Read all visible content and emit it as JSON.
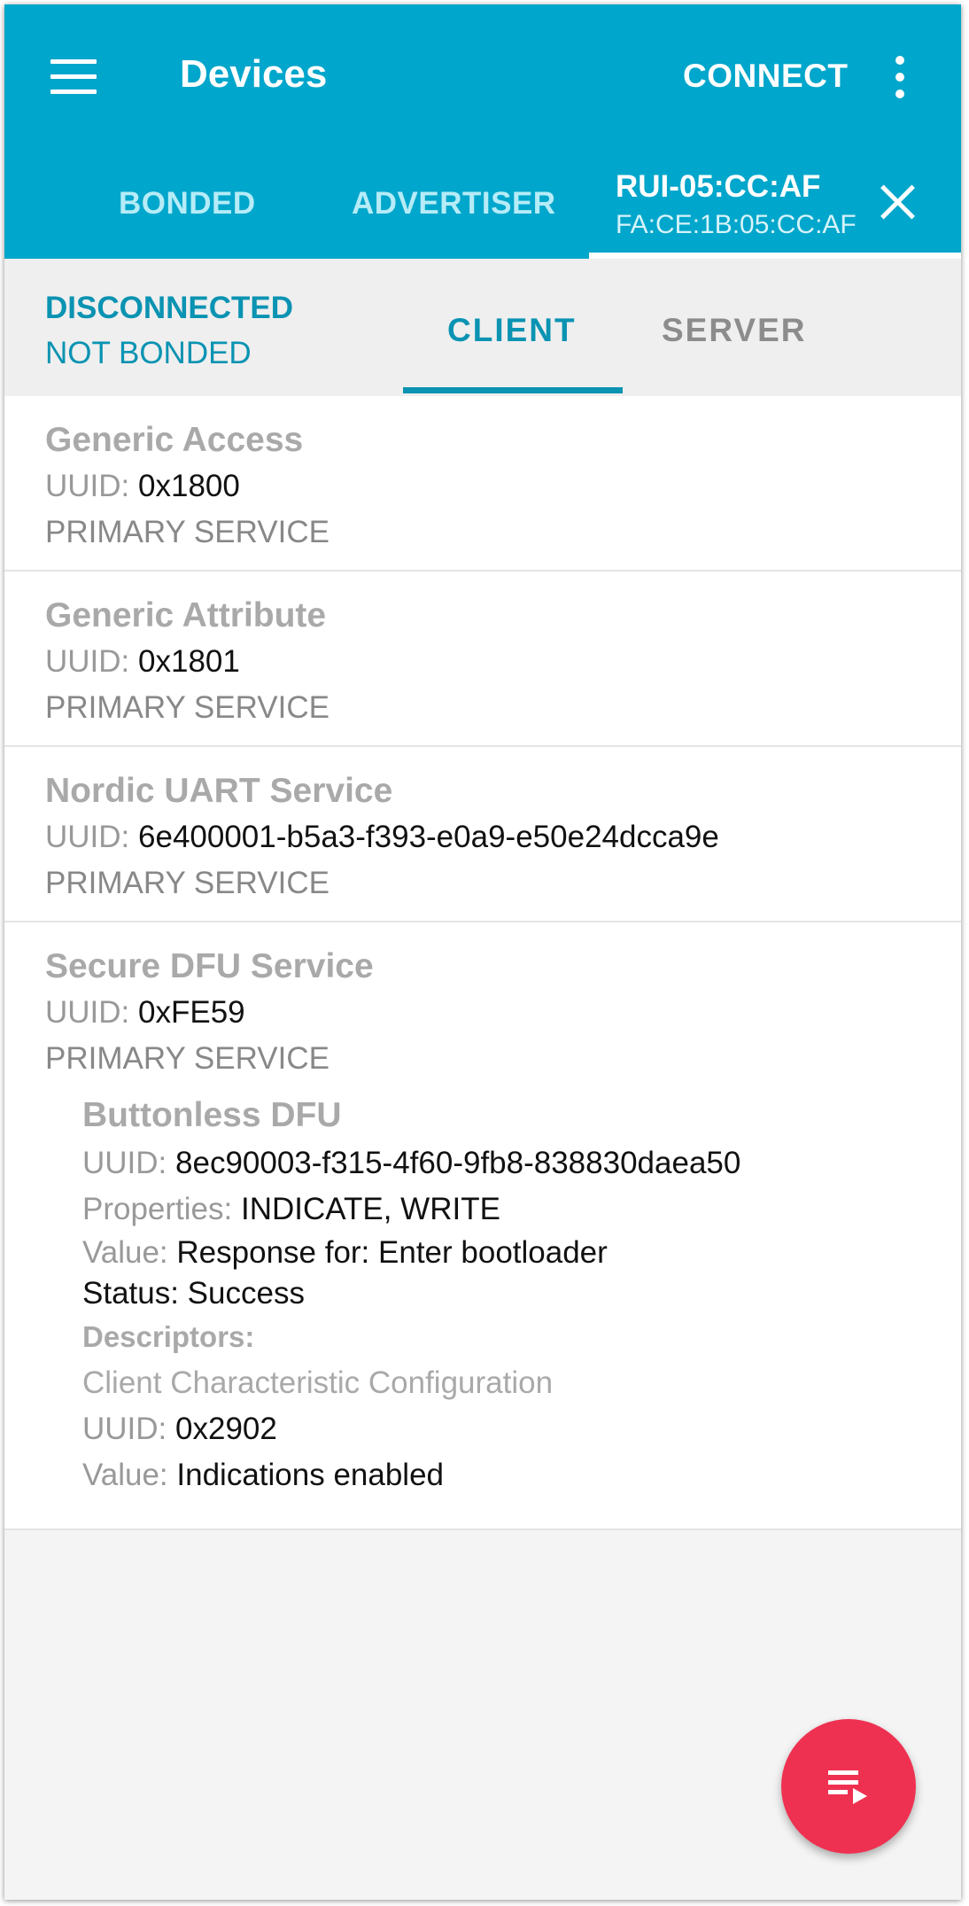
{
  "appbar": {
    "title": "Devices",
    "connect_label": "CONNECT",
    "tabs": [
      {
        "label": "BONDED"
      },
      {
        "label": "ADVERTISER"
      }
    ],
    "device_tab": {
      "name": "RUI-05:CC:AF",
      "address": "FA:CE:1B:05:CC:AF"
    }
  },
  "colors": {
    "primary": "#00a6cb",
    "accent": "#ef3151",
    "status": "#0a93b2"
  },
  "subbar": {
    "connection_status": "DISCONNECTED",
    "bond_status": "NOT BONDED",
    "tabs": [
      {
        "label": "CLIENT",
        "selected": true
      },
      {
        "label": "SERVER",
        "selected": false
      }
    ]
  },
  "services": [
    {
      "name": "Generic Access",
      "uuid_label": "UUID:",
      "uuid": "0x1800",
      "type": "PRIMARY SERVICE"
    },
    {
      "name": "Generic Attribute",
      "uuid_label": "UUID:",
      "uuid": "0x1801",
      "type": "PRIMARY SERVICE"
    },
    {
      "name": "Nordic UART Service",
      "uuid_label": "UUID:",
      "uuid": "6e400001-b5a3-f393-e0a9-e50e24dcca9e",
      "type": "PRIMARY SERVICE"
    },
    {
      "name": "Secure DFU Service",
      "uuid_label": "UUID:",
      "uuid": "0xFE59",
      "type": "PRIMARY SERVICE",
      "characteristic": {
        "name": "Buttonless DFU",
        "uuid_label": "UUID:",
        "uuid": "8ec90003-f315-4f60-9fb8-838830daea50",
        "properties_label": "Properties:",
        "properties": "INDICATE, WRITE",
        "value_label": "Value:",
        "value_line1": "Response for: Enter bootloader",
        "value_line2": "Status: Success",
        "descriptors_label": "Descriptors:",
        "descriptor": {
          "name": "Client Characteristic Configuration",
          "uuid_label": "UUID:",
          "uuid": "0x2902",
          "value_label": "Value:",
          "value": "Indications enabled"
        }
      }
    }
  ],
  "fab": {
    "icon": "playlist-play-icon"
  }
}
